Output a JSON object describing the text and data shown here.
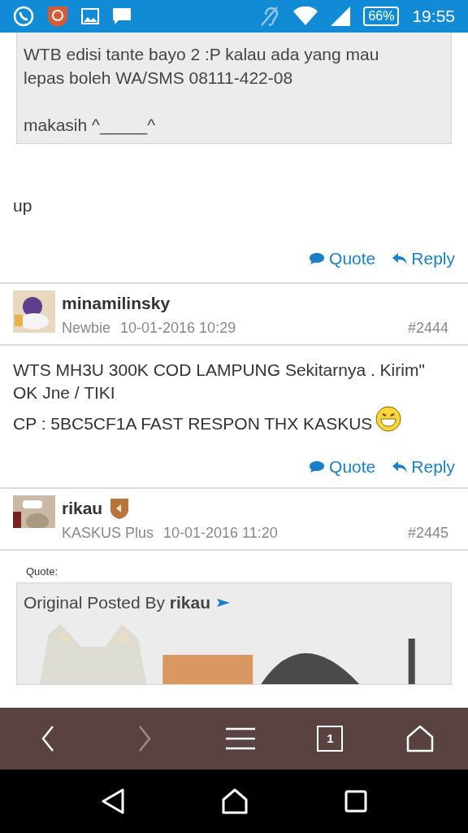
{
  "status_bar": {
    "battery": "66%",
    "time": "19:55"
  },
  "top_quote": {
    "lines": [
      "WTB edisi tante bayo 2 :P kalau ada yang mau lepas boleh WA/SMS 08111-422-08",
      "makasih ^_____^"
    ]
  },
  "top_post": {
    "body": "up",
    "actions": [
      "Quote",
      "Reply"
    ]
  },
  "posts": [
    {
      "kind": "text",
      "username": "minamilinsky",
      "has_badge": false,
      "rank": "Newbie",
      "date": "10-01-2016 10:29",
      "number": "#2444",
      "body": [
        "WTS MH3U 300K COD LAMPUNG Sekitarnya . Kirim\" OK Jne / TIKI",
        "CP : 5BC5CF1A FAST RESPON THX KASKUS"
      ],
      "actions": [
        "Quote",
        "Reply"
      ]
    },
    {
      "kind": "quote",
      "username": "rikau",
      "has_badge": true,
      "rank": "KASKUS Plus",
      "date": "10-01-2016 11:20",
      "number": "#2445",
      "quote_label": "Quote:",
      "quote_prefix": "Original Posted By",
      "quote_author": "rikau"
    }
  ],
  "toolbar": {
    "buttons": [
      {
        "kind": "back",
        "disabled": false
      },
      {
        "kind": "forward",
        "disabled": true
      },
      {
        "kind": "menu",
        "disabled": false
      },
      {
        "kind": "tabs",
        "disabled": false,
        "count": "1"
      },
      {
        "kind": "home",
        "disabled": false
      }
    ]
  }
}
